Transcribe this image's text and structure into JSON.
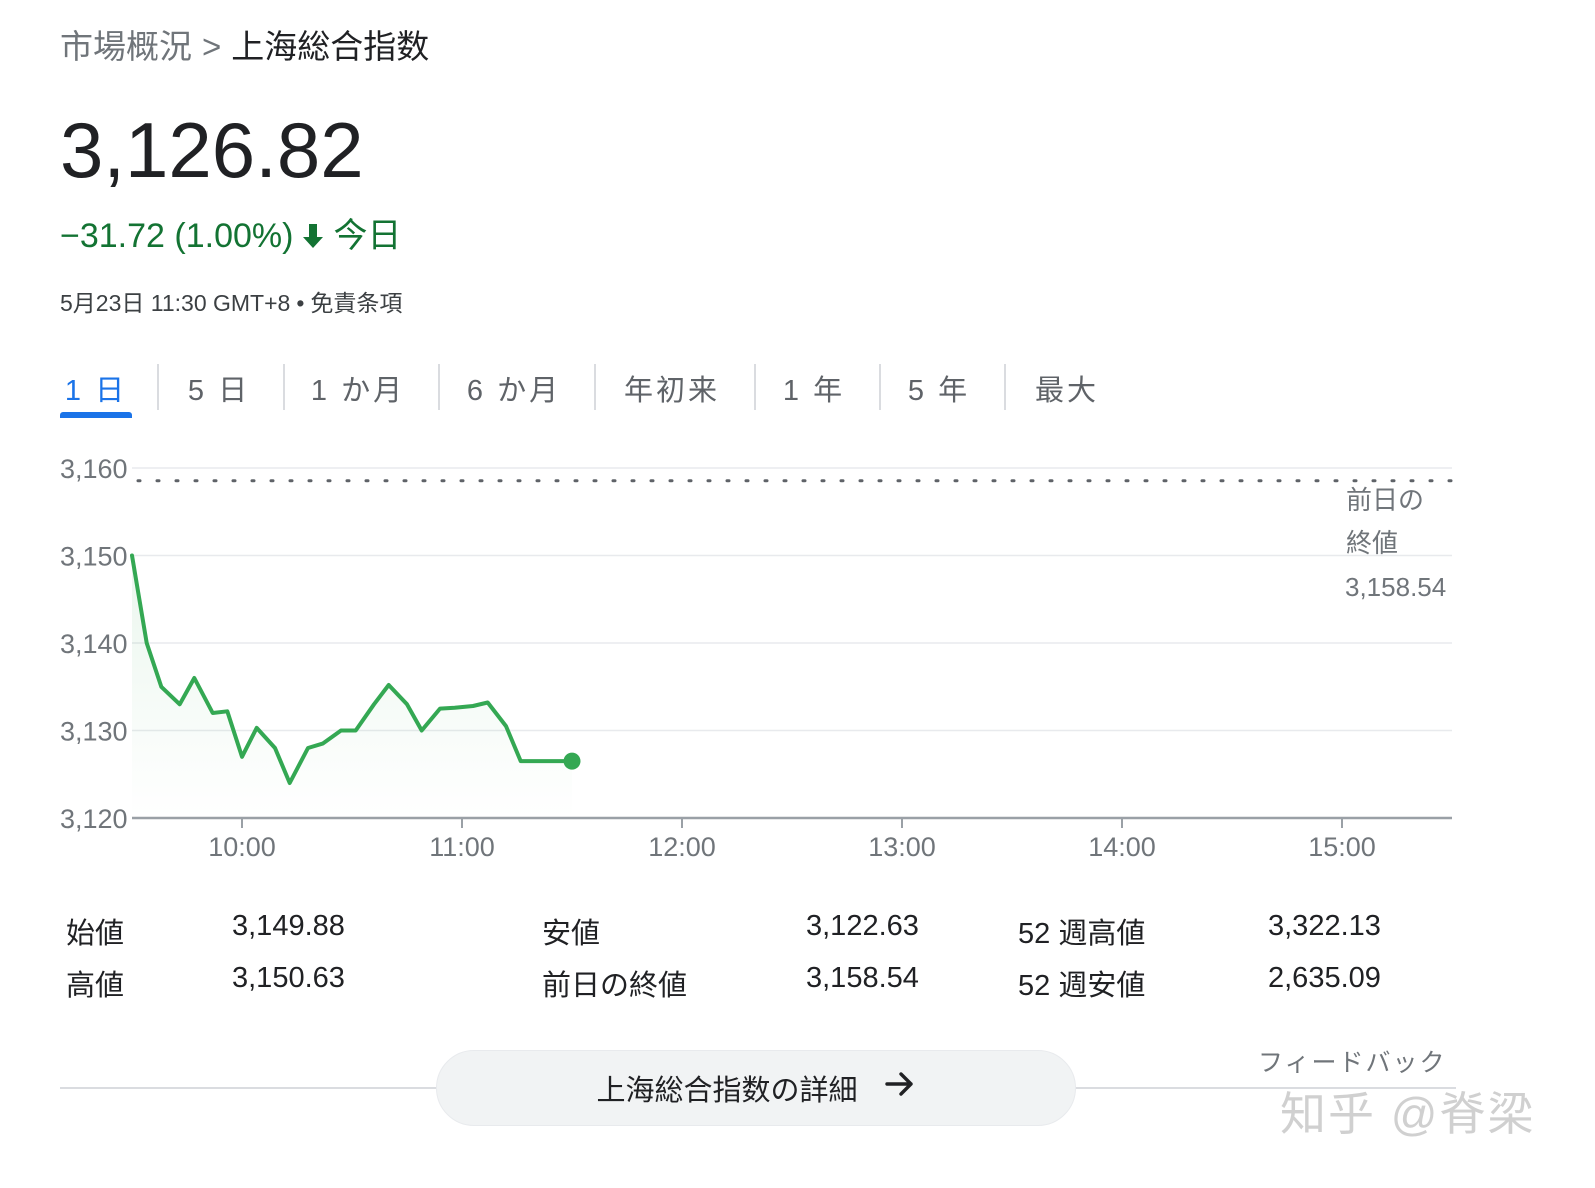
{
  "breadcrumb": {
    "parent": "市場概況",
    "separator": ">",
    "current": "上海総合指数"
  },
  "price": "3,126.82",
  "change": {
    "text": "−31.72 (1.00%)",
    "direction": "down",
    "period": "今日",
    "color": "#137333"
  },
  "meta": {
    "timestamp": "5月23日 11:30 GMT+8",
    "separator": "•",
    "disclaimer": "免責条項"
  },
  "tabs": [
    {
      "label": "1 日",
      "active": true
    },
    {
      "label": "5 日",
      "active": false
    },
    {
      "label": "1 か月",
      "active": false
    },
    {
      "label": "6 か月",
      "active": false
    },
    {
      "label": "年初来",
      "active": false
    },
    {
      "label": "1 年",
      "active": false
    },
    {
      "label": "5 年",
      "active": false
    },
    {
      "label": "最大",
      "active": false
    }
  ],
  "chart_data": {
    "type": "line",
    "series": [
      {
        "x": [
          "09:30",
          "09:34",
          "09:38",
          "09:43",
          "09:47",
          "09:52",
          "09:56",
          "10:00",
          "10:04",
          "10:09",
          "10:13",
          "10:18",
          "10:22",
          "10:27",
          "10:31",
          "10:36",
          "10:40",
          "10:45",
          "10:49",
          "10:54",
          "10:58",
          "11:03",
          "11:07",
          "11:12",
          "11:16",
          "11:21",
          "11:25",
          "11:30"
        ],
        "values": [
          3150.0,
          3140.0,
          3135.0,
          3133.0,
          3136.0,
          3132.0,
          3132.2,
          3127.0,
          3130.3,
          3128.0,
          3124.0,
          3128.0,
          3128.5,
          3130.0,
          3130.0,
          3133.0,
          3135.2,
          3133.0,
          3130.0,
          3132.5,
          3132.6,
          3132.8,
          3133.2,
          3130.5,
          3126.5,
          3126.5,
          3126.5,
          3126.5
        ]
      }
    ],
    "ylim": [
      3120,
      3160
    ],
    "yticks": [
      "3,160",
      "3,150",
      "3,140",
      "3,130",
      "3,120"
    ],
    "ytick_values": [
      3160,
      3150,
      3140,
      3130,
      3120
    ],
    "xlim": [
      "09:30",
      "15:30"
    ],
    "xticks": [
      "10:00",
      "11:00",
      "12:00",
      "13:00",
      "14:00",
      "15:00"
    ],
    "grid": true,
    "line_color": "#34a853",
    "previous_close": {
      "label_line1": "前日の",
      "label_line2": "終値",
      "value": 3158.54,
      "value_text": "3,158.54"
    }
  },
  "stats": {
    "left": [
      {
        "label": "始値",
        "value": "3,149.88"
      },
      {
        "label": "高値",
        "value": "3,150.63"
      }
    ],
    "middle": [
      {
        "label": "安値",
        "value": "3,122.63"
      },
      {
        "label": "前日の終値",
        "value": "3,158.54"
      }
    ],
    "right": [
      {
        "label": "52 週高値",
        "value": "3,322.13"
      },
      {
        "label": "52 週安値",
        "value": "2,635.09"
      }
    ]
  },
  "more_button": {
    "label": "上海総合指数の詳細",
    "icon": "arrow-right-icon"
  },
  "feedback": "フィードバック",
  "watermark": "知乎 @脊梁"
}
